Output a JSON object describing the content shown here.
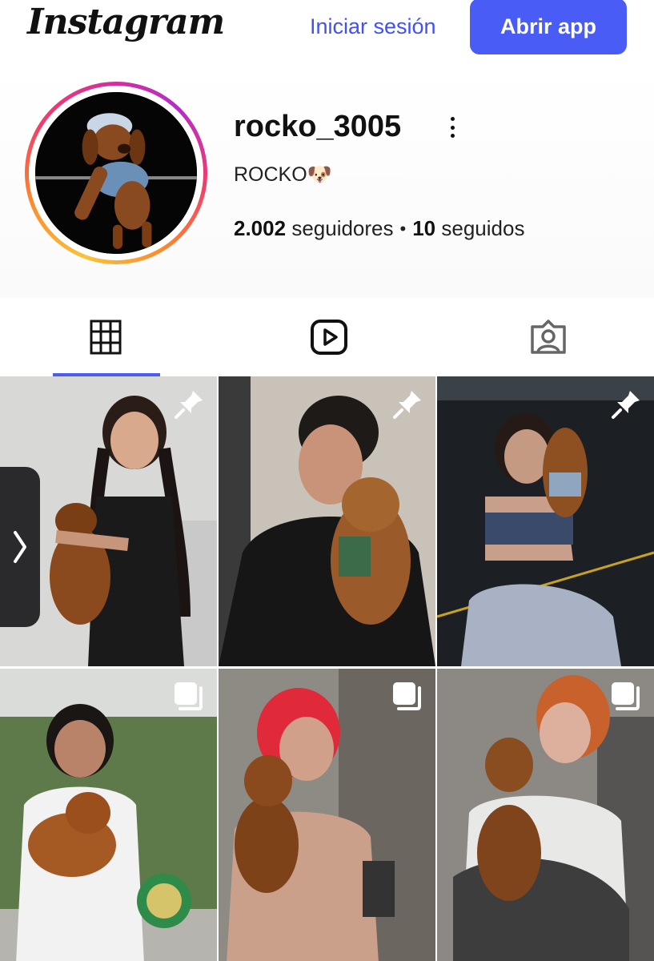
{
  "header": {
    "logo_text": "Instagram",
    "login_label": "Iniciar sesión",
    "open_app_label": "Abrir app"
  },
  "profile": {
    "username": "rocko_3005",
    "bio": "ROCKO🐶",
    "followers_count": "2.002",
    "followers_label": "seguidores",
    "separator": "•",
    "following_count": "10",
    "following_label": "seguidos"
  },
  "tabs": [
    {
      "icon": "grid-icon",
      "active": true
    },
    {
      "icon": "reels-icon",
      "active": false
    },
    {
      "icon": "tagged-icon",
      "active": false
    }
  ],
  "posts": [
    {
      "badge": "pin-icon",
      "description": "woman with braids holding dachshund"
    },
    {
      "badge": "pin-icon",
      "description": "man holding dachshund"
    },
    {
      "badge": "pin-icon",
      "description": "woman in gym holding dachshund"
    },
    {
      "badge": "carousel-icon",
      "description": "woman holding dachshund outdoors"
    },
    {
      "badge": "carousel-icon",
      "description": "red-haired woman holding dachshund"
    },
    {
      "badge": "carousel-icon",
      "description": "woman kissing dachshund"
    }
  ],
  "colors": {
    "accent": "#4a5cf6",
    "link": "#4150f7"
  }
}
